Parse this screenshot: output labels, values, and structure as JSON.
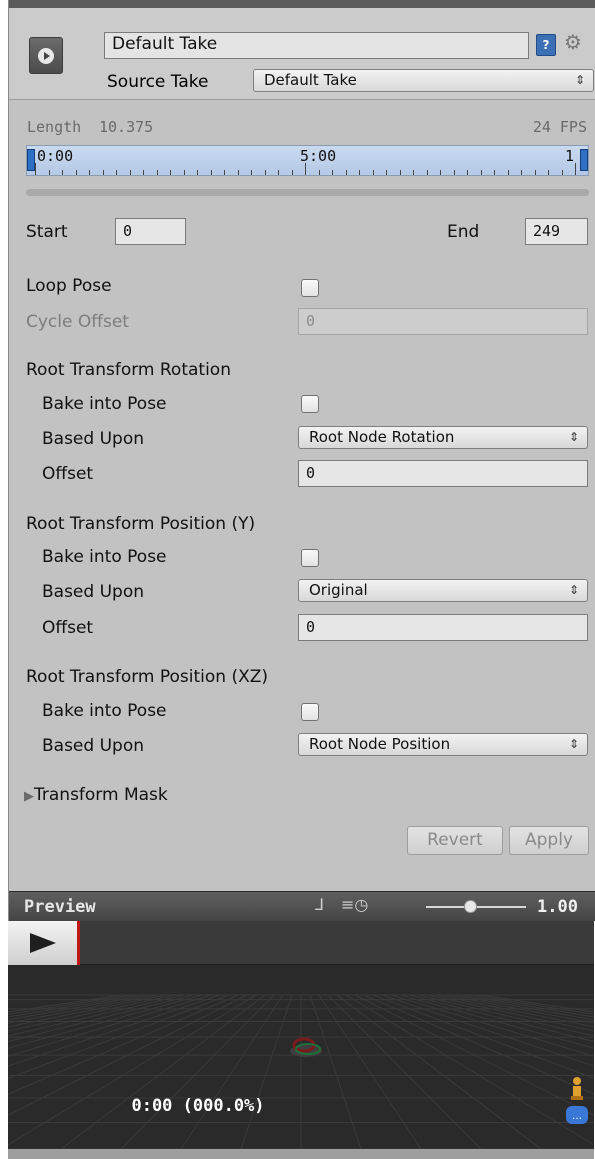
{
  "header": {
    "clip_name": "Default Take",
    "source_take_label": "Source Take",
    "source_take_value": "Default Take"
  },
  "timeline": {
    "length_label": "Length",
    "length_value": "10.375",
    "fps": "24 FPS",
    "tick_start": "0:00",
    "tick_mid": "5:00",
    "tick_end": "1"
  },
  "range": {
    "start_label": "Start",
    "start_value": "0",
    "end_label": "End",
    "end_value": "249"
  },
  "loop": {
    "loop_pose_label": "Loop Pose",
    "loop_pose_checked": false,
    "cycle_offset_label": "Cycle Offset",
    "cycle_offset_value": "0"
  },
  "root_rotation": {
    "heading": "Root Transform Rotation",
    "bake_label": "Bake into Pose",
    "bake_checked": false,
    "based_upon_label": "Based Upon",
    "based_upon_value": "Root Node Rotation",
    "offset_label": "Offset",
    "offset_value": "0"
  },
  "root_position_y": {
    "heading": "Root Transform Position (Y)",
    "bake_label": "Bake into Pose",
    "bake_checked": false,
    "based_upon_label": "Based Upon",
    "based_upon_value": "Original",
    "offset_label": "Offset",
    "offset_value": "0"
  },
  "root_position_xz": {
    "heading": "Root Transform Position (XZ)",
    "bake_label": "Bake into Pose",
    "bake_checked": false,
    "based_upon_label": "Based Upon",
    "based_upon_value": "Root Node Position"
  },
  "transform_mask": {
    "label": "Transform Mask"
  },
  "actions": {
    "revert_label": "Revert",
    "apply_label": "Apply"
  },
  "preview": {
    "title": "Preview",
    "speed_value": "1.00",
    "speed_fraction": 0.45,
    "time_readout": "0:00 (000.0%)"
  },
  "colors": {
    "panel_bg": "#c2c2c2",
    "timeline_bg": "#b4c9e6",
    "marker_blue": "#2f6fc5",
    "play_red": "#c01717",
    "viewport_bg": "#2a2a2a"
  },
  "icons": [
    "clip-icon",
    "help-book-icon",
    "gear-icon",
    "dropdown-arrows-icon",
    "foldout-arrow-icon",
    "pivot-icon",
    "speed-clock-icon",
    "play-icon",
    "avatar-icon",
    "more-icon"
  ]
}
